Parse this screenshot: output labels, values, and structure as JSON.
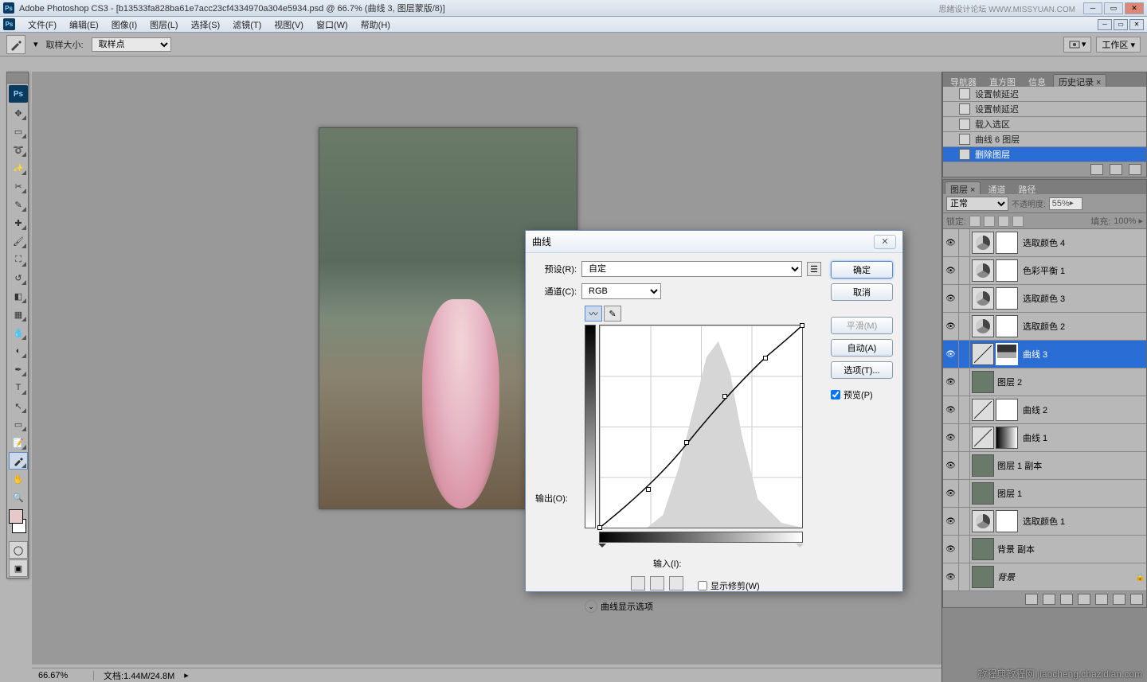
{
  "app": {
    "title_prefix": "Adobe Photoshop CS3 - ",
    "doc_title": "[b13533fa828ba61e7acc23cf4334970a304e5934.psd @ 66.7% (曲线 3, 图层蒙版/8)]",
    "watermark_top": "思緒设计论坛  WWW.MISSYUAN.COM",
    "watermark_bottom": "教程典教程网  jiaocheng.chazidian.com"
  },
  "menu": [
    "文件(F)",
    "编辑(E)",
    "图像(I)",
    "图层(L)",
    "选择(S)",
    "滤镜(T)",
    "视图(V)",
    "窗口(W)",
    "帮助(H)"
  ],
  "options_bar": {
    "sample_label": "取样大小:",
    "sample_value": "取样点",
    "workspace_label": "工作区 ▾"
  },
  "status": {
    "zoom": "66.67%",
    "doc_label": "文档:",
    "doc_size": "1.44M/24.8M"
  },
  "history_panel": {
    "tabs": [
      "导航器",
      "直方图",
      "信息",
      "历史记录 ×"
    ],
    "items": [
      {
        "label": "设置帧延迟"
      },
      {
        "label": "设置帧延迟"
      },
      {
        "label": "载入选区"
      },
      {
        "label": "曲线 6 图层"
      },
      {
        "label": "删除图层",
        "selected": true
      }
    ]
  },
  "layers_panel": {
    "tabs": [
      "图层 ×",
      "通道",
      "路径"
    ],
    "blend": "正常",
    "opacity_label": "不透明度:",
    "opacity": "55%",
    "lock_label": "锁定:",
    "fill_label": "填充:",
    "fill": "100%",
    "layers": [
      {
        "name": "选取颜色 4",
        "type": "adj",
        "mask": "white"
      },
      {
        "name": "色彩平衡 1",
        "type": "adj",
        "mask": "white"
      },
      {
        "name": "选取颜色 3",
        "type": "adj",
        "mask": "white"
      },
      {
        "name": "选取颜色 2",
        "type": "adj",
        "mask": "white"
      },
      {
        "name": "曲线 3",
        "type": "curves",
        "mask": "img",
        "selected": true
      },
      {
        "name": "图层 2",
        "type": "img"
      },
      {
        "name": "曲线 2",
        "type": "curves",
        "mask": "white"
      },
      {
        "name": "曲线 1",
        "type": "curves",
        "mask": "grad"
      },
      {
        "name": "图层 1 副本",
        "type": "img"
      },
      {
        "name": "图层 1",
        "type": "img"
      },
      {
        "name": "选取颜色 1",
        "type": "adj",
        "mask": "white"
      },
      {
        "name": "背景 副本",
        "type": "img"
      },
      {
        "name": "背景",
        "type": "img",
        "italic": true,
        "locked": true
      }
    ]
  },
  "dialog": {
    "title": "曲线",
    "preset_label": "预设(R):",
    "preset": "自定",
    "channel_label": "通道(C):",
    "channel": "RGB",
    "output_label": "输出(O):",
    "input_label": "输入(I):",
    "show_clip": "显示修剪(W)",
    "show_options": "曲线显示选项",
    "ok": "确定",
    "cancel": "取消",
    "smooth": "平滑(M)",
    "auto": "自动(A)",
    "options_btn": "选项(T)...",
    "preview": "预览(P)"
  }
}
